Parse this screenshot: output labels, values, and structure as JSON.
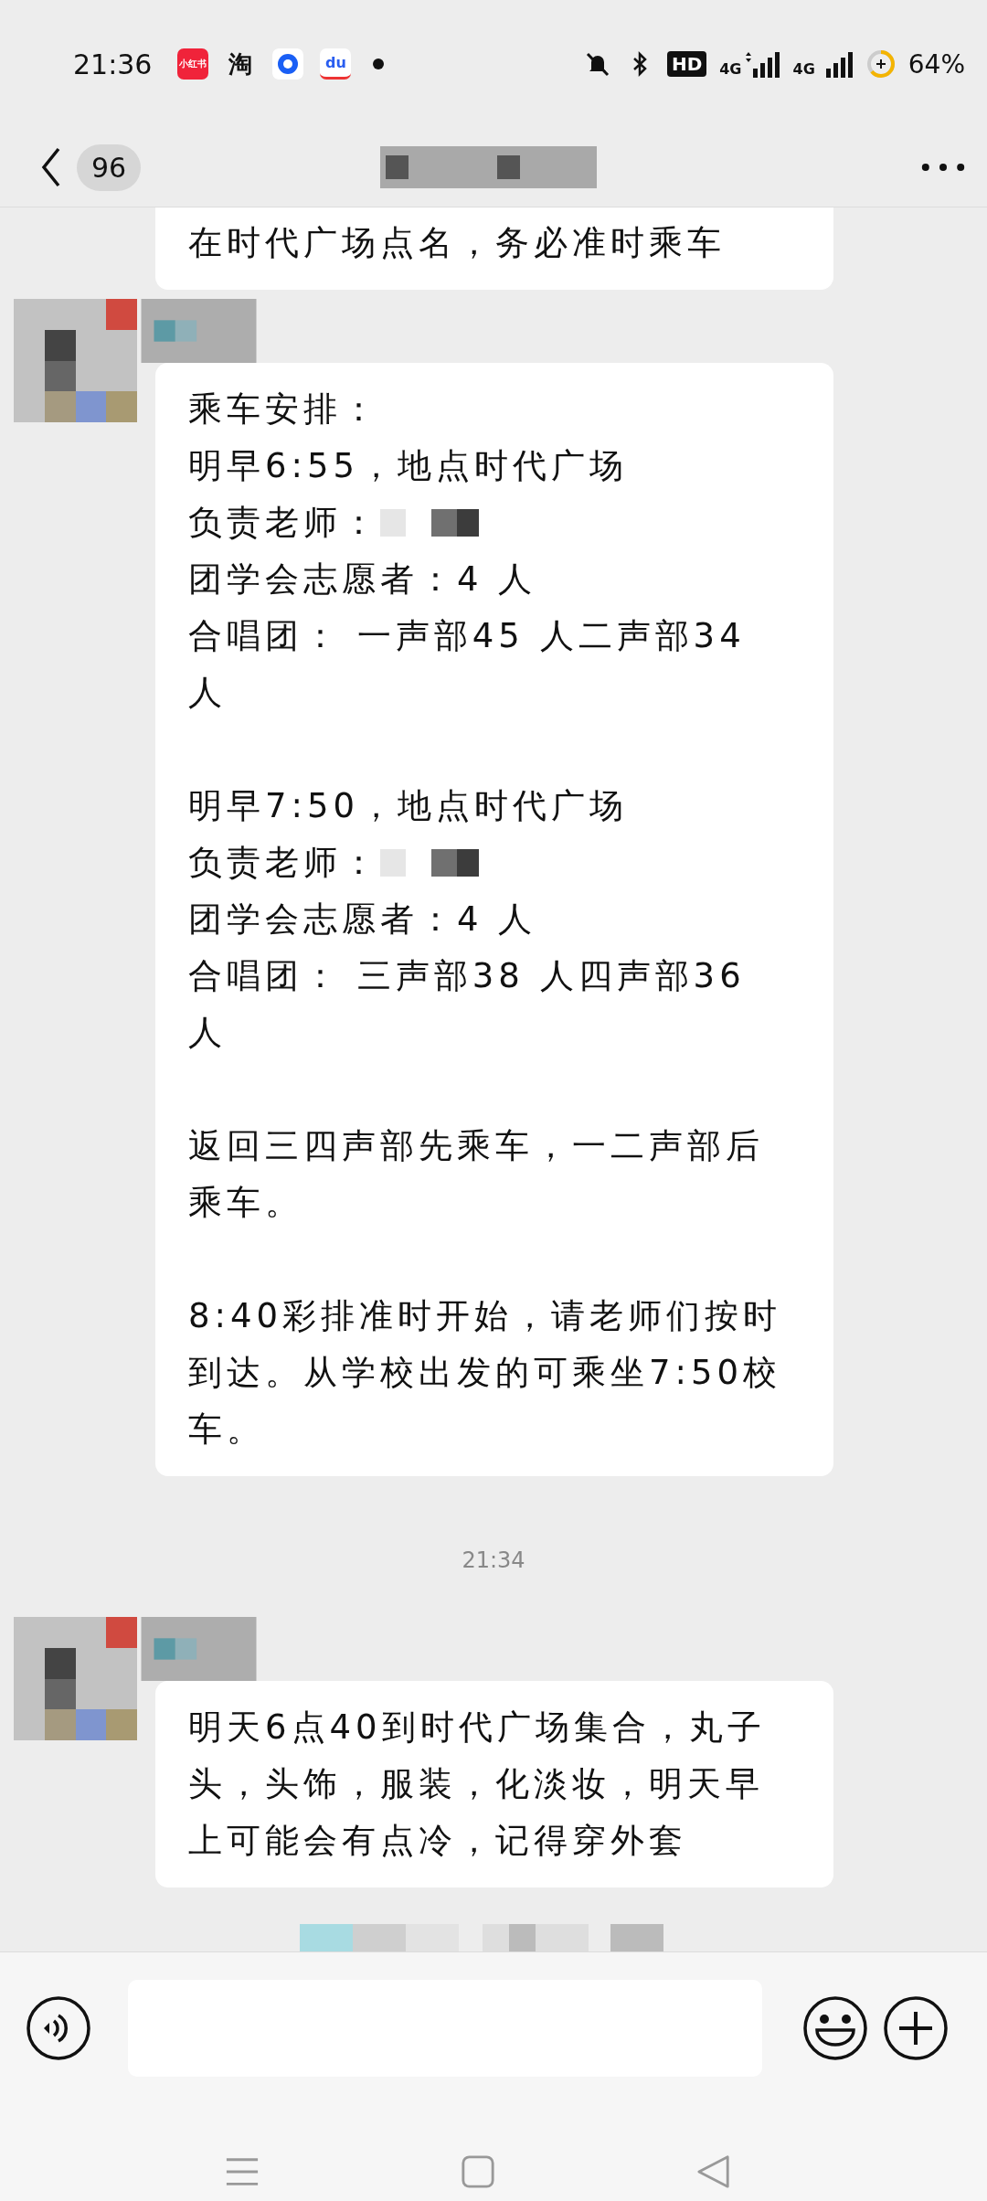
{
  "status_bar": {
    "time": "21:36",
    "app_icons": [
      {
        "kind": "redbook",
        "label": "小红书"
      },
      {
        "kind": "glyph",
        "label": "淘"
      },
      {
        "kind": "bluering"
      },
      {
        "kind": "paw",
        "label": "du"
      }
    ],
    "hd_label": "HD",
    "sims": [
      {
        "label": "4G",
        "arrows": true
      },
      {
        "label": "4G",
        "arrows": false
      }
    ],
    "battery": "64%"
  },
  "header": {
    "unread": "96"
  },
  "messages": [
    {
      "kind": "partial",
      "blocks": [
        [
          {
            "text": "在时代广场点名，务必准时乘车"
          }
        ]
      ]
    },
    {
      "kind": "incoming",
      "blocks": [
        [
          {
            "text": "乘车安排：",
            "redacted": false
          },
          {
            "text": "明早6:55，地点时代广场",
            "redacted": false
          },
          {
            "text": "负责老师：",
            "redacted": true
          },
          {
            "text": "团学会志愿者：4 人",
            "redacted": false
          },
          {
            "text": "合唱团： 一声部45 人二声部34 人",
            "redacted": false
          }
        ],
        [
          {
            "text": "明早7:50，地点时代广场",
            "redacted": false
          },
          {
            "text": "负责老师：",
            "redacted": true
          },
          {
            "text": "团学会志愿者：4 人",
            "redacted": false
          },
          {
            "text": "合唱团： 三声部38 人四声部36 人",
            "redacted": false
          }
        ],
        [
          {
            "text": "返回三四声部先乘车，一二声部后乘车。",
            "redacted": false
          }
        ],
        [
          {
            "text": "8:40彩排准时开始，请老师们按时到达。从学校出发的可乘坐7:50校车。",
            "redacted": false
          }
        ]
      ]
    },
    {
      "kind": "time",
      "text": "21:34"
    },
    {
      "kind": "incoming",
      "blocks": [
        [
          {
            "text": "明天6点40到时代广场集合，丸子头，头饰，服装，化淡妆，明天早上可能会有点冷，记得穿外套",
            "redacted": false
          }
        ]
      ]
    },
    {
      "kind": "notice"
    }
  ]
}
